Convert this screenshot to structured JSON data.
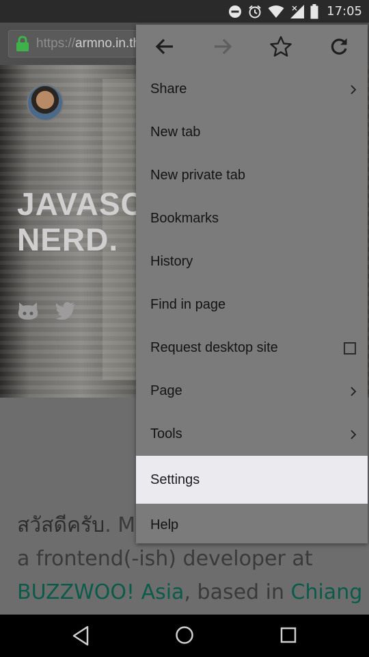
{
  "status_bar": {
    "time": "17:05",
    "icons": [
      "do-not-disturb-icon",
      "alarm-icon",
      "wifi-icon",
      "signal-no-data-icon",
      "battery-icon"
    ]
  },
  "toolbar": {
    "url_scheme": "https://",
    "url_host": "armno.in.th"
  },
  "page": {
    "hero_title_line1": "JAVASC",
    "hero_title_line2": "NERD.",
    "para_thai": "สวัสดีครับ",
    "para_line1_rest": ". M",
    "para_line2": "a frontend(-ish) developer at",
    "para_link1": "BUZZWOO! Asia",
    "para_line3_mid": ", based in ",
    "para_link2": "Chiang"
  },
  "menu": {
    "top_icons": [
      "back-arrow-icon",
      "forward-arrow-icon",
      "bookmark-star-icon",
      "reload-icon"
    ],
    "items": [
      {
        "label": "Share",
        "trail": "chevron"
      },
      {
        "label": "New tab",
        "trail": ""
      },
      {
        "label": "New private tab",
        "trail": ""
      },
      {
        "label": "Bookmarks",
        "trail": ""
      },
      {
        "label": "History",
        "trail": ""
      },
      {
        "label": "Find in page",
        "trail": ""
      },
      {
        "label": "Request desktop site",
        "trail": "checkbox"
      },
      {
        "label": "Page",
        "trail": "chevron"
      },
      {
        "label": "Tools",
        "trail": "chevron"
      },
      {
        "label": "Settings",
        "trail": "",
        "highlighted": true
      },
      {
        "label": "Help",
        "trail": ""
      }
    ]
  },
  "colors": {
    "menu_bg": "#7b7b7b",
    "highlight_bg": "#ebebef",
    "link": "#0c5b4a",
    "lock": "#3fb14b"
  }
}
